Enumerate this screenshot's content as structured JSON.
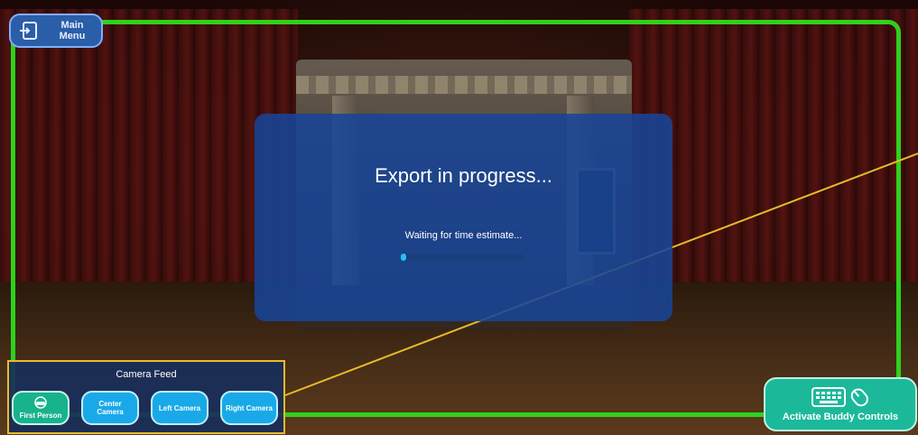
{
  "header": {
    "main_menu_label": "Main Menu"
  },
  "dialog": {
    "title": "Export in progress...",
    "status_text": "Waiting for time estimate...",
    "progress": 0.03
  },
  "camera_feed": {
    "title": "Camera Feed",
    "buttons": [
      {
        "label": "First Person",
        "icon": "vr-headset-icon",
        "active": true
      },
      {
        "label": "Center Camera",
        "active": false
      },
      {
        "label": "Left Camera",
        "active": false
      },
      {
        "label": "Right Camera",
        "active": false
      }
    ]
  },
  "buddy_controls": {
    "label": "Activate Buddy Controls",
    "icons": [
      "keyboard-icon",
      "mouse-icon"
    ]
  },
  "colors": {
    "frame_green": "#2fd11d",
    "dialog_blue": "#1844a0",
    "progress_cyan": "#27c1f5",
    "highlight_yellow": "#e8bb2c",
    "button_blue": "#19a9e8",
    "button_teal": "#17b38c"
  }
}
